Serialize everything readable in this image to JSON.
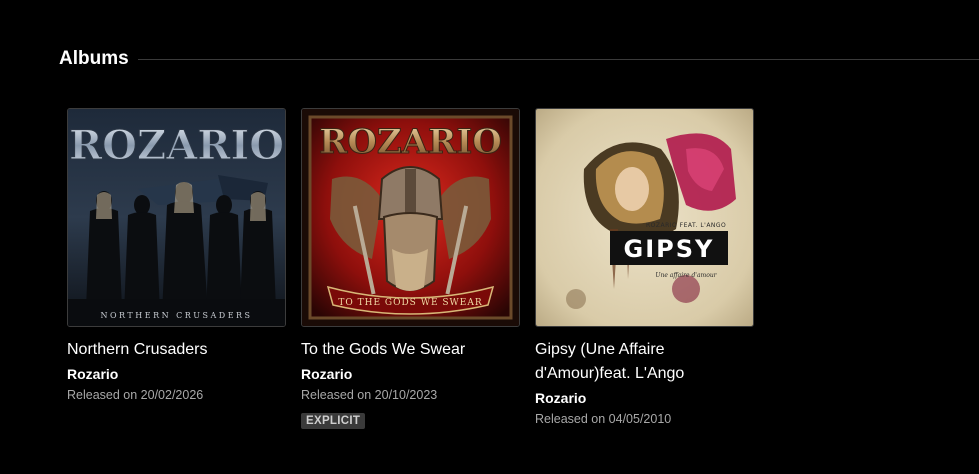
{
  "section": {
    "title": "Albums"
  },
  "albums": [
    {
      "title": "Northern Crusaders",
      "artist": "Rozario",
      "released": "Released on 20/02/2026",
      "cover_art": {
        "band_text": "ROZARIO",
        "subtitle_text": "NORTHERN CRUSADERS"
      }
    },
    {
      "title": "To the Gods We Swear",
      "artist": "Rozario",
      "released": "Released on 20/10/2023",
      "badge": "EXPLICIT",
      "cover_art": {
        "band_text": "ROZARIO",
        "subtitle_text": "TO THE GODS WE SWEAR"
      }
    },
    {
      "title": "Gipsy (Une Affaire d'Amour)feat. L'Ango",
      "artist": "Rozario",
      "released": "Released on 04/05/2010",
      "cover_art": {
        "band_text": "ROZARIO FEAT. L'ANGO",
        "title_text": "GIPSY",
        "subtitle_text": "Une affaire d'amour"
      }
    }
  ],
  "colors": {
    "background": "#000000",
    "text": "#ffffff",
    "muted_text": "#a8a8a8",
    "badge_bg": "#3a3a3a",
    "rule": "#3a3a3a"
  }
}
